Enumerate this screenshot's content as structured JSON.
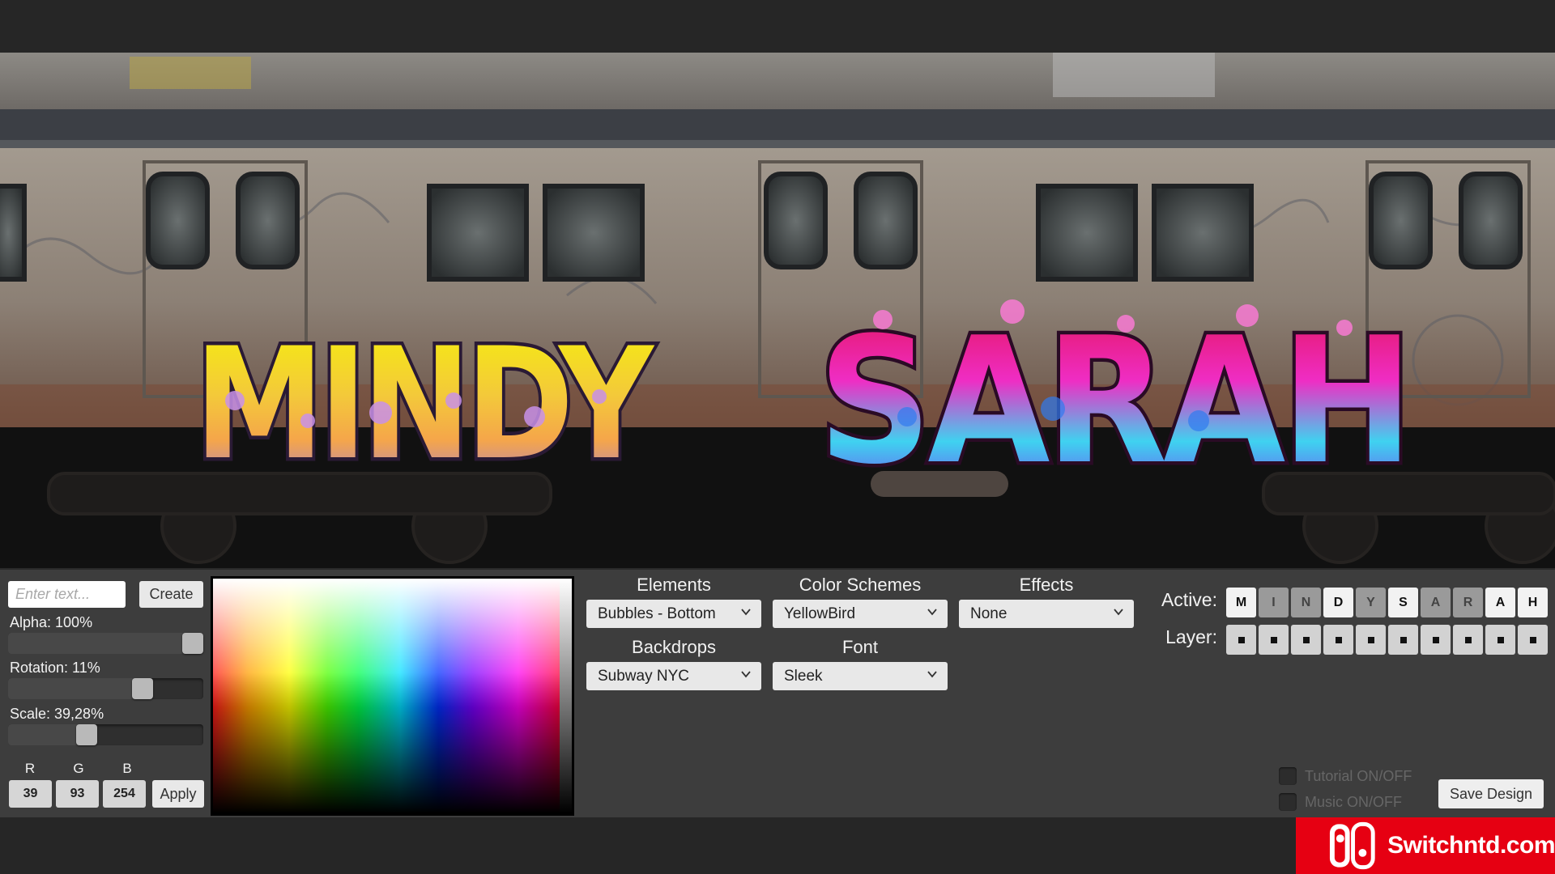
{
  "canvas": {
    "tags": [
      "MINDY",
      "SARAH"
    ]
  },
  "controls": {
    "text_input_placeholder": "Enter text...",
    "create_label": "Create",
    "alpha_label": "Alpha: 100%",
    "alpha_value": 1.0,
    "rotation_label": "Rotation: 11%",
    "rotation_value": 0.11,
    "scale_label": "Scale: 39,28%",
    "scale_value": 0.3928,
    "r_label": "R",
    "g_label": "G",
    "b_label": "B",
    "r_value": "39",
    "g_value": "93",
    "b_value": "254",
    "apply_label": "Apply"
  },
  "dropdowns": {
    "elements_label": "Elements",
    "elements_value": "Bubbles - Bottom",
    "color_schemes_label": "Color Schemes",
    "color_schemes_value": "YellowBird",
    "effects_label": "Effects",
    "effects_value": "None",
    "backdrops_label": "Backdrops",
    "backdrops_value": "Subway NYC",
    "font_label": "Font",
    "font_value": "Sleek"
  },
  "letters": {
    "active_label": "Active:",
    "layer_label": "Layer:",
    "items": [
      {
        "char": "M",
        "on": true
      },
      {
        "char": "I",
        "on": false
      },
      {
        "char": "N",
        "on": false
      },
      {
        "char": "D",
        "on": true
      },
      {
        "char": "Y",
        "on": false
      },
      {
        "char": "S",
        "on": true
      },
      {
        "char": "A",
        "on": false
      },
      {
        "char": "R",
        "on": false
      },
      {
        "char": "A",
        "on": true
      },
      {
        "char": "H",
        "on": true
      }
    ]
  },
  "options": {
    "tutorial_label": "Tutorial ON/OFF",
    "music_label": "Music ON/OFF",
    "save_label": "Save Design"
  },
  "watermark": {
    "text": "Switchntd.com"
  },
  "colors": {
    "accent_red": "#e60012",
    "panel_bg": "#3d3d3d"
  }
}
